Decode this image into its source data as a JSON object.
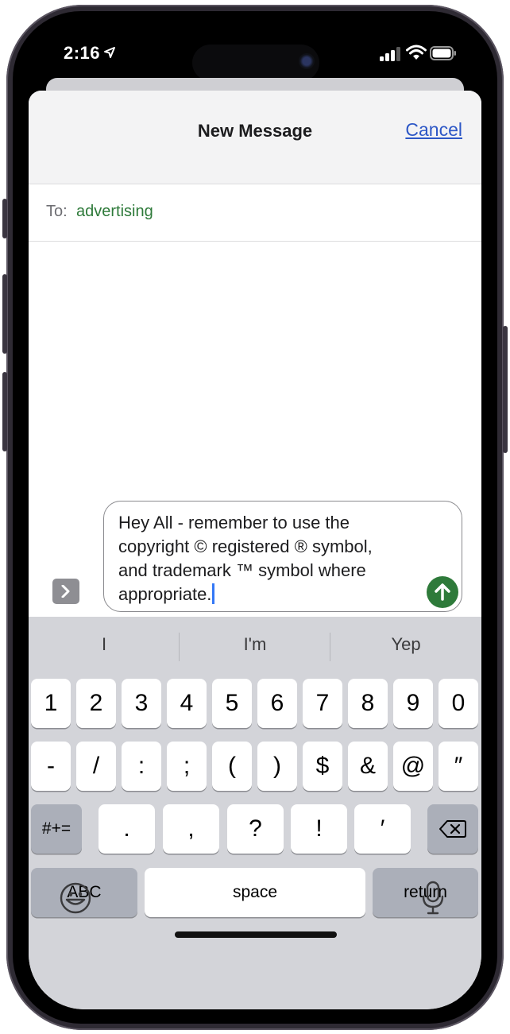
{
  "status_bar": {
    "time": "2:16"
  },
  "header": {
    "title": "New Message",
    "cancel_label": "Cancel"
  },
  "to_field": {
    "label": "To:",
    "recipient": "advertising"
  },
  "compose": {
    "lines": [
      "Hey All - remember to use the",
      "copyright © registered ® symbol,",
      "and trademark ™ symbol where",
      "appropriate."
    ]
  },
  "keyboard": {
    "predictions": [
      "I",
      "I'm",
      "Yep"
    ],
    "row1": [
      "1",
      "2",
      "3",
      "4",
      "5",
      "6",
      "7",
      "8",
      "9",
      "0"
    ],
    "row2": [
      "-",
      "/",
      ":",
      ";",
      "(",
      ")",
      "$",
      "&",
      "@",
      "″"
    ],
    "row3": {
      "symbols_label": "#+=",
      "keys": [
        ".",
        ",",
        "?",
        "!",
        "′"
      ]
    },
    "row4": {
      "abc_label": "ABC",
      "space_label": "space",
      "return_label": "return"
    }
  },
  "colors": {
    "accent_green": "#2e7a3a",
    "link_blue": "#2d57c6"
  },
  "icons": [
    "location-arrow-icon",
    "signal-icon",
    "wifi-icon",
    "battery-icon",
    "chevron-right-icon",
    "send-arrow-icon",
    "delete-icon",
    "emoji-icon",
    "microphone-icon"
  ]
}
